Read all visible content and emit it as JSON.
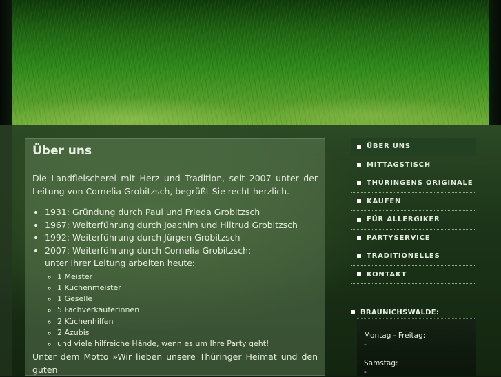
{
  "content": {
    "title": "Über uns",
    "intro": "Die Landfleischerei mit Herz und Tradition, seit 2007 unter der Leitung von Cornelia Grobitzsch, begrüßt Sie recht herzlich.",
    "history": [
      "1931: Gründung durch Paul und Frieda Grobitzsch",
      "1967: Weiterführung durch Joachim und Hiltrud Grobitzsch",
      "1992: Weiterführung durch Jürgen Grobitzsch",
      "2007: Weiterführung durch Cornelia Grobitzsch;"
    ],
    "staff_intro": "unter Ihrer Leitung arbeiten heute:",
    "staff": [
      "1 Meister",
      "1 Küchenmeister",
      "1 Geselle",
      "5 Fachverkäuferinnen",
      "2 Küchenhilfen",
      "2 Azubis",
      "und viele hilfreiche Hände, wenn es um Ihre Party geht!"
    ],
    "motto": "Unter dem Motto »Wir lieben unsere Thüringer Heimat und den guten"
  },
  "nav": {
    "items": [
      {
        "label": "ÜBER UNS",
        "active": true
      },
      {
        "label": "MITTAGSTISCH"
      },
      {
        "label": "THÜRINGENS ORIGINALE"
      },
      {
        "label": "KAUFEN"
      },
      {
        "label": "FÜR ALLERGIKER"
      },
      {
        "label": "PARTYSERVICE"
      },
      {
        "label": "TRADITIONELLES"
      },
      {
        "label": "KONTAKT"
      }
    ]
  },
  "sidebar_box": {
    "title": "BRAUNICHSWALDE:",
    "line1": "Montag - Freitag:",
    "line2": "-",
    "line3": "Samstag:",
    "line4": "-"
  },
  "colors": {
    "accent_active_nav": "#244022",
    "text": "#e6eddf"
  }
}
